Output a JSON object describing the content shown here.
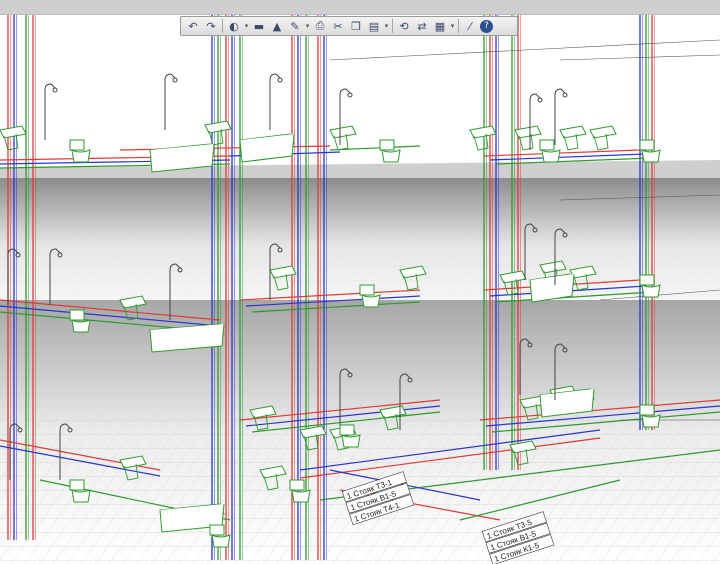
{
  "toolbar": {
    "buttons": [
      {
        "name": "undo-icon",
        "glyph": "↶"
      },
      {
        "name": "redo-icon",
        "glyph": "↷"
      },
      {
        "name": "sync-icon",
        "glyph": "◐"
      },
      {
        "name": "open-icon",
        "glyph": "▬"
      },
      {
        "name": "save-icon",
        "glyph": "▲"
      },
      {
        "name": "edit-icon",
        "glyph": "✎"
      },
      {
        "name": "print-icon",
        "glyph": "⎙"
      },
      {
        "name": "cut-icon",
        "glyph": "✂"
      },
      {
        "name": "copy-icon",
        "glyph": "❐"
      },
      {
        "name": "paste-icon",
        "glyph": "▤"
      },
      {
        "name": "refresh-icon",
        "glyph": "⟲"
      },
      {
        "name": "match-properties-icon",
        "glyph": "⇄"
      },
      {
        "name": "layers-icon",
        "glyph": "▦"
      },
      {
        "name": "measure-icon",
        "glyph": "⁄"
      },
      {
        "name": "help-icon",
        "glyph": "?"
      }
    ]
  },
  "labels": {
    "top": [
      "1 Стояк Т3-1",
      "1 Стояк В1-5",
      "1 Стояк Т4-1"
    ],
    "bottom": [
      "1 Стояк Т3-5",
      "1 Стояк В1-5",
      "1 Стояк К1-5"
    ]
  },
  "colors": {
    "water_pipe": "#e03a3a",
    "drain_pipe": "#2a35d0",
    "fixture": "#2e9a2e",
    "grid": "#c8c8c8"
  }
}
